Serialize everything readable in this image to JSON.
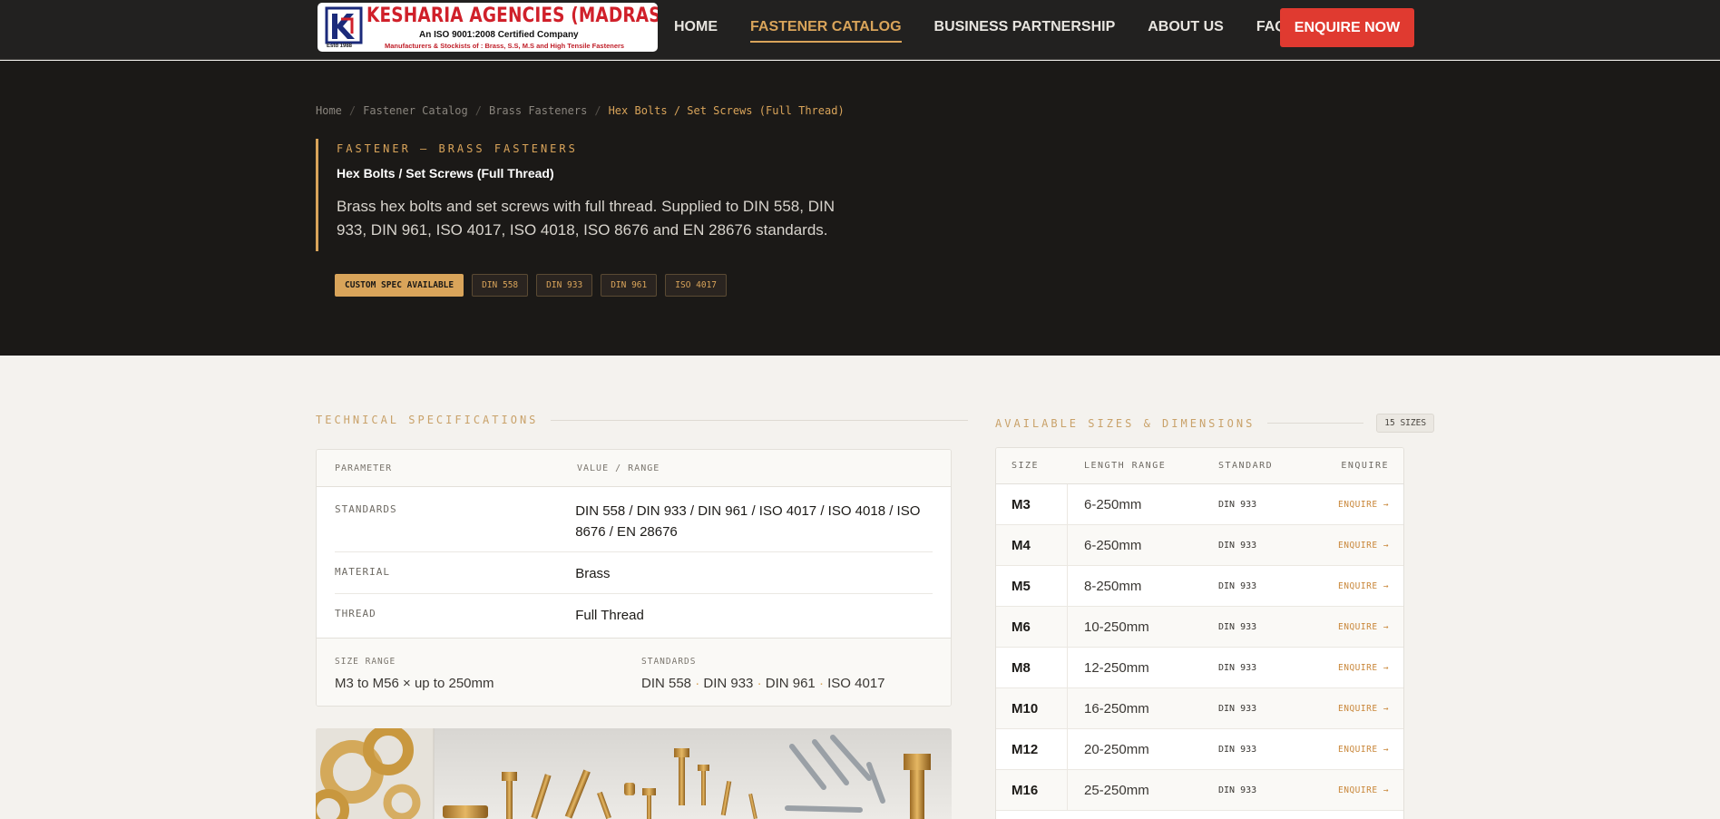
{
  "nav": {
    "logo": {
      "title": "KESHARIA AGENCIES (MADRAS)",
      "cert": "An ISO 9001:2008 Certified Company",
      "sub": "Manufacturers & Stockists of : Brass, S.S, M.S and High Tensile Fasteners",
      "est": "Estd 1988"
    },
    "links": [
      "HOME",
      "FASTENER CATALOG",
      "BUSINESS PARTNERSHIP",
      "ABOUT US",
      "FAQ"
    ],
    "active_link": "FASTENER CATALOG",
    "cta": "ENQUIRE NOW"
  },
  "breadcrumb": [
    "Home",
    "Fastener Catalog",
    "Brass Fasteners",
    "Hex Bolts / Set Screws (Full Thread)"
  ],
  "hero": {
    "eyebrow": "FASTENER — BRASS FASTENERS",
    "title": "Hex Bolts / Set Screws (Full Thread)",
    "description": "Brass hex bolts and set screws with full thread. Supplied to DIN 558, DIN 933, DIN 961, ISO 4017, ISO 4018, ISO 8676 and EN 28676 standards.",
    "chips": [
      "CUSTOM SPEC AVAILABLE",
      "DIN 558",
      "DIN 933",
      "DIN 961",
      "ISO 4017"
    ]
  },
  "specs": {
    "section_title": "TECHNICAL SPECIFICATIONS",
    "col_param": "PARAMETER",
    "col_value": "VALUE / RANGE",
    "rows": [
      {
        "key": "STANDARDS",
        "value": "DIN 558 / DIN 933 / DIN 961 / ISO 4017 / ISO 4018 / ISO 8676 / EN 28676"
      },
      {
        "key": "MATERIAL",
        "value": "Brass"
      },
      {
        "key": "THREAD",
        "value": "Full Thread"
      }
    ],
    "footer": {
      "size_range_label": "SIZE RANGE",
      "size_range_value": "M3 to M56 × up to 250mm",
      "standards_label": "STANDARDS",
      "standards_list": [
        "DIN 558",
        "DIN 933",
        "DIN 961",
        "ISO 4017"
      ],
      "separator": " · "
    }
  },
  "sizes": {
    "section_title": "AVAILABLE SIZES & DIMENSIONS",
    "count": "15 SIZES",
    "columns": [
      "SIZE",
      "LENGTH RANGE",
      "STANDARD",
      "ENQUIRE"
    ],
    "enquire_label": "ENQUIRE →",
    "rows": [
      {
        "size": "M3",
        "length": "6-250mm",
        "standard": "DIN 933"
      },
      {
        "size": "M4",
        "length": "6-250mm",
        "standard": "DIN 933"
      },
      {
        "size": "M5",
        "length": "8-250mm",
        "standard": "DIN 933"
      },
      {
        "size": "M6",
        "length": "10-250mm",
        "standard": "DIN 933"
      },
      {
        "size": "M8",
        "length": "12-250mm",
        "standard": "DIN 933"
      },
      {
        "size": "M10",
        "length": "16-250mm",
        "standard": "DIN 933"
      },
      {
        "size": "M12",
        "length": "20-250mm",
        "standard": "DIN 933"
      },
      {
        "size": "M16",
        "length": "25-250mm",
        "standard": "DIN 933"
      }
    ]
  },
  "colors": {
    "accent": "#d9a45a",
    "cta": "#e03a30",
    "hero_bg": "#1b1917",
    "nav_bg": "#222120",
    "page_bg": "#f4f2ee",
    "logo_red": "#d0202a"
  }
}
